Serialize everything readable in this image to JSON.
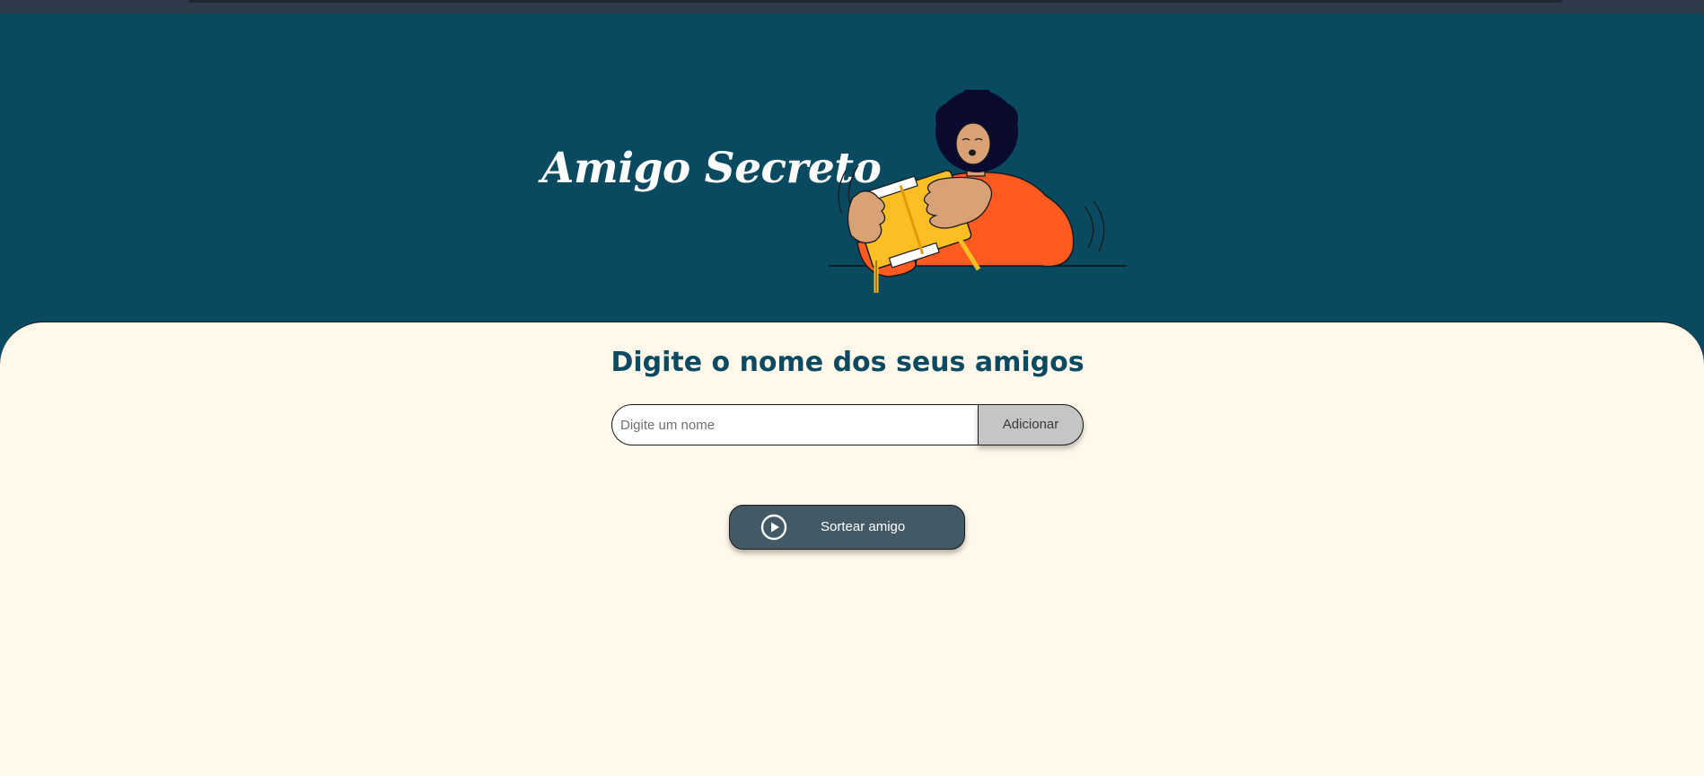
{
  "header": {
    "title": "Amigo Secreto",
    "illustration_icon": "person-opening-gift-illustration"
  },
  "main": {
    "subtitle": "Digite o nome dos seus amigos",
    "name_input": {
      "value": "",
      "placeholder": "Digite um nome"
    },
    "add_button_label": "Adicionar",
    "draw_button": {
      "label": "Sortear amigo",
      "icon": "play-circle-icon"
    }
  },
  "colors": {
    "header_bg": "#094a61",
    "main_bg": "#fff8eb",
    "title_text": "#ffffff",
    "subtitle_text": "#0b4a60",
    "add_button_bg": "#c5c5c5",
    "draw_button_bg": "#435a66",
    "accent_orange": "#ff5a1f",
    "accent_yellow": "#fbbf24"
  }
}
